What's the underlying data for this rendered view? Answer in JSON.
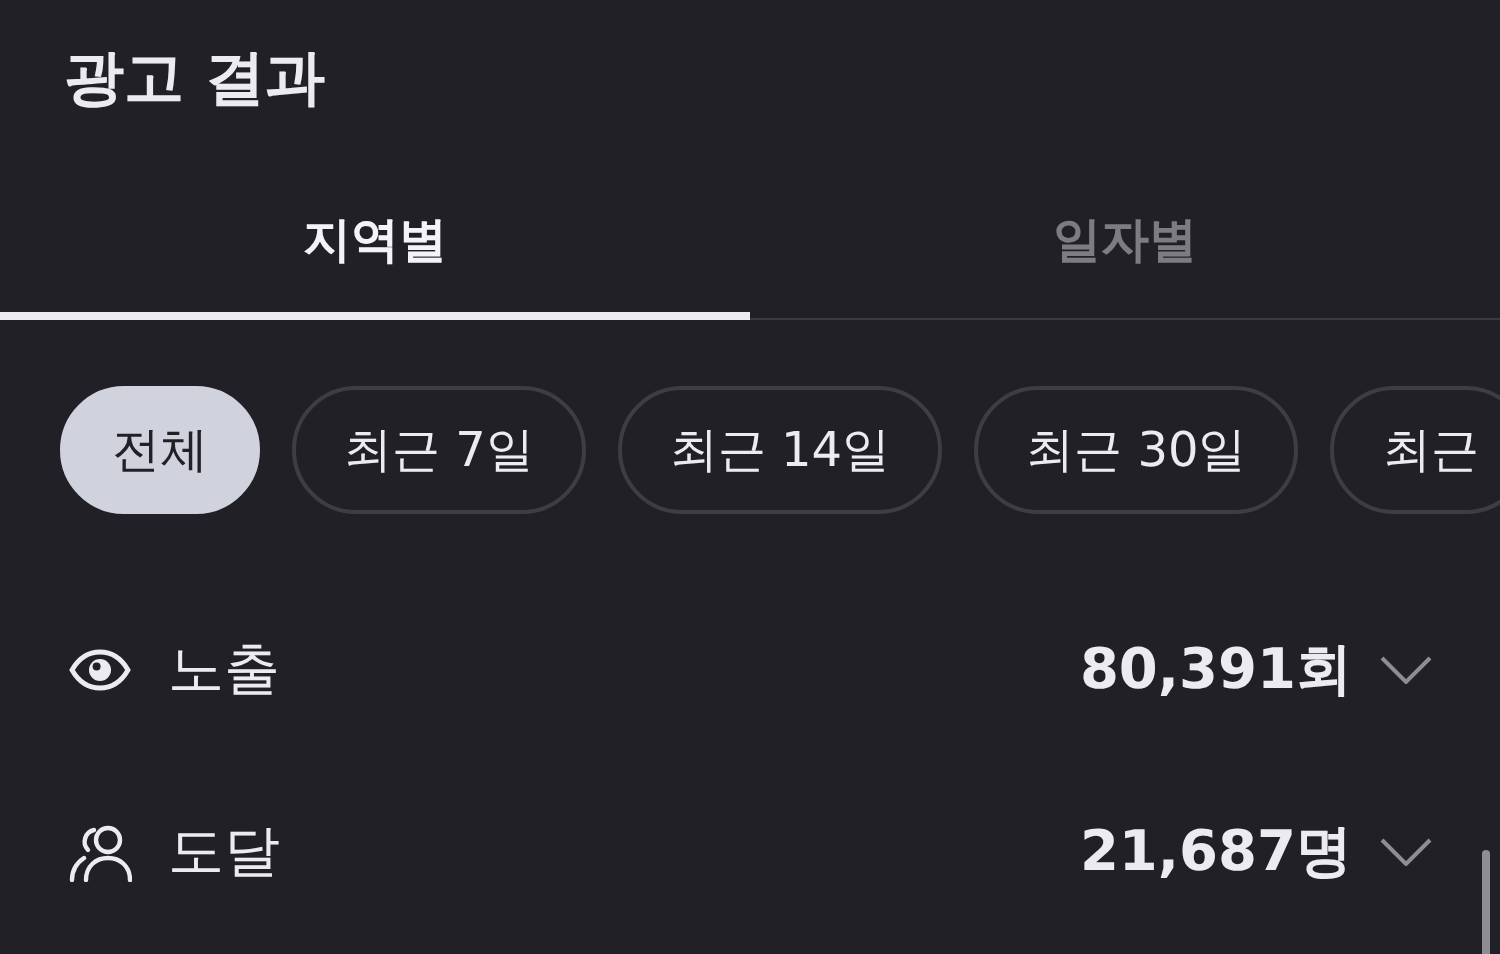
{
  "title": "광고 결과",
  "tabs": [
    {
      "label": "지역별",
      "selected": true
    },
    {
      "label": "일자별",
      "selected": false
    }
  ],
  "filters": [
    {
      "label": "전체",
      "selected": true
    },
    {
      "label": "최근 7일",
      "selected": false
    },
    {
      "label": "최근 14일",
      "selected": false
    },
    {
      "label": "최근 30일",
      "selected": false
    },
    {
      "label": "최근",
      "selected": false
    }
  ],
  "metrics": [
    {
      "kind": "eye",
      "label": "노출",
      "value": "80,391회",
      "expanded": false
    },
    {
      "kind": "people",
      "label": "도달",
      "value": "21,687명",
      "expanded": false
    }
  ]
}
